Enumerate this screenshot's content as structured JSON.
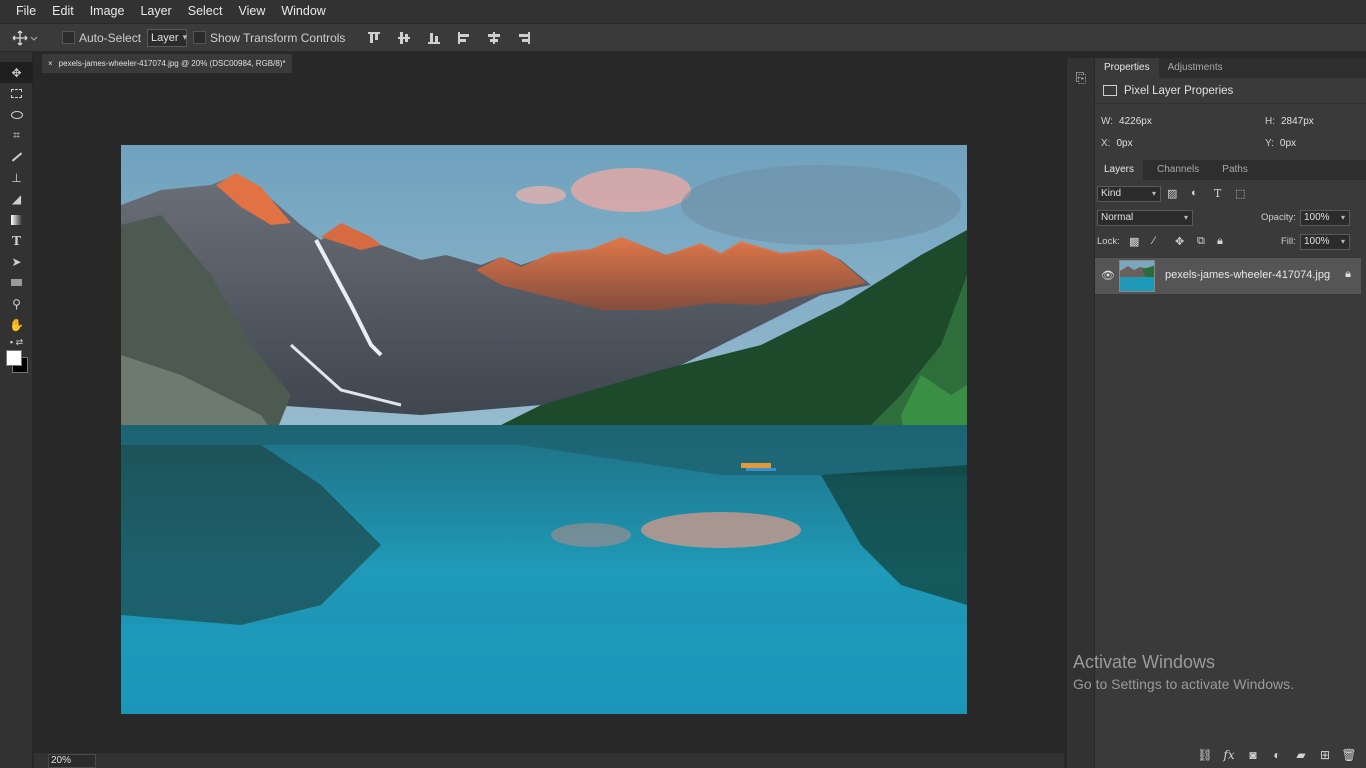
{
  "menu": [
    "File",
    "Edit",
    "Image",
    "Layer",
    "Select",
    "View",
    "Window"
  ],
  "options": {
    "auto_select_label": "Auto-Select",
    "auto_select_target": "Layer",
    "show_transform_label": "Show Transform Controls"
  },
  "document_tab": {
    "close": "×",
    "title": "pexels-james-wheeler-417074.jpg @ 20% (DSC00984, RGB/8)*"
  },
  "status": {
    "zoom": "20%"
  },
  "properties": {
    "tabs": [
      "Properties",
      "Adjustments"
    ],
    "title": "Pixel Layer Properies",
    "w_label": "W:",
    "w_value": "4226px",
    "h_label": "H:",
    "h_value": "2847px",
    "x_label": "X:",
    "x_value": "0px",
    "y_label": "Y:",
    "y_value": "0px"
  },
  "layers": {
    "tabs": [
      "Layers",
      "Channels",
      "Paths"
    ],
    "filter_kind": "Kind",
    "blend_mode": "Normal",
    "opacity_label": "Opacity:",
    "opacity_value": "100%",
    "lock_label": "Lock:",
    "fill_label": "Fill:",
    "fill_value": "100%",
    "items": [
      {
        "name": "pexels-james-wheeler-417074.jpg"
      }
    ]
  },
  "watermark": {
    "line1": "Activate Windows",
    "line2": "Go to Settings to activate Windows."
  }
}
